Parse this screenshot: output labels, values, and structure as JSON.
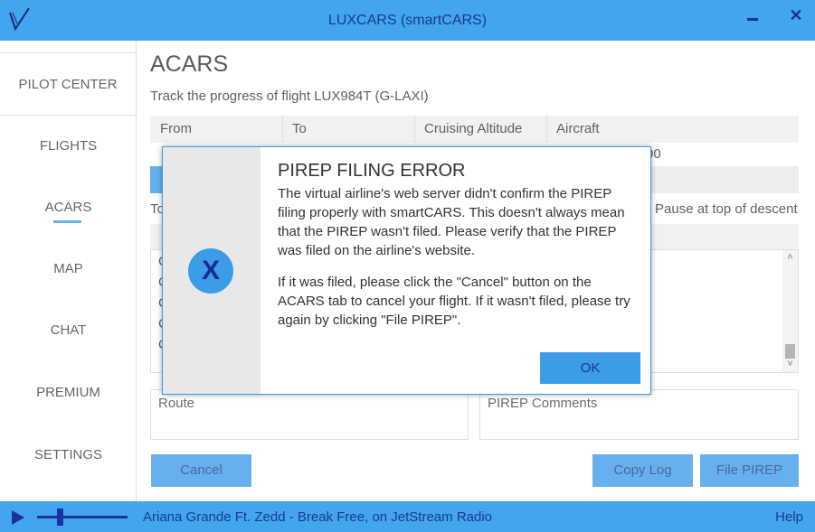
{
  "window": {
    "title": "LUXCARS (smartCARS)",
    "logo_icon": "v-check-logo",
    "accent_color": "#41a5f0"
  },
  "sidebar": {
    "items": [
      {
        "label": "PILOT CENTER"
      },
      {
        "label": "FLIGHTS"
      },
      {
        "label": "ACARS"
      },
      {
        "label": "MAP"
      },
      {
        "label": "CHAT"
      },
      {
        "label": "PREMIUM"
      },
      {
        "label": "SETTINGS"
      }
    ],
    "active": "ACARS"
  },
  "acars": {
    "title": "ACARS",
    "subtitle": "Track the progress of flight LUX984T (G-LAXI)",
    "columns": [
      "From",
      "To",
      "Cruising Altitude",
      "Aircraft"
    ],
    "aircraft_value_partial": "00",
    "to_partial": "To",
    "pause_label": "Pause at top of descent",
    "log_partial_lines": [
      "C",
      "C",
      "C",
      "C",
      "C"
    ],
    "route_label": "Route",
    "comments_label": "PIREP Comments",
    "cancel_label": "Cancel",
    "copy_log_label": "Copy Log",
    "file_pirep_label": "File PIREP"
  },
  "dialog": {
    "title": "PIREP FILING ERROR",
    "icon": "x-error-icon",
    "icon_text": "X",
    "message_1": "The virtual airline's web server didn't confirm the PIREP filing properly with smartCARS. This doesn't always mean that the PIREP wasn't filed. Please verify that the PIREP was filed on the airline's website.",
    "message_2": "If it was filed, please click the \"Cancel\" button on the ACARS tab to cancel your flight. If it wasn't filed, please try again by clicking \"File PIREP\".",
    "ok_label": "OK"
  },
  "player": {
    "now_playing": "Ariana Grande Ft. Zedd - Break Free, on JetStream Radio",
    "volume": 0.25,
    "help_label": "Help"
  }
}
